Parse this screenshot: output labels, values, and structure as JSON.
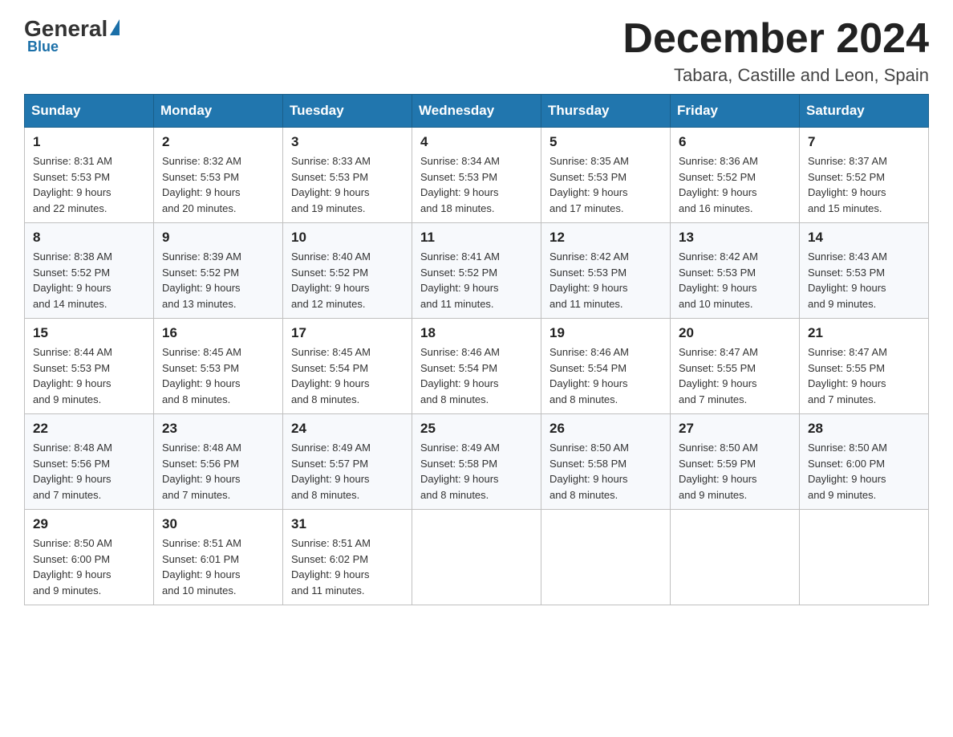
{
  "logo": {
    "general": "General",
    "blue": "Blue"
  },
  "header": {
    "month": "December 2024",
    "location": "Tabara, Castille and Leon, Spain"
  },
  "days_of_week": [
    "Sunday",
    "Monday",
    "Tuesday",
    "Wednesday",
    "Thursday",
    "Friday",
    "Saturday"
  ],
  "weeks": [
    [
      {
        "day": "1",
        "sunrise": "8:31 AM",
        "sunset": "5:53 PM",
        "daylight": "9 hours and 22 minutes."
      },
      {
        "day": "2",
        "sunrise": "8:32 AM",
        "sunset": "5:53 PM",
        "daylight": "9 hours and 20 minutes."
      },
      {
        "day": "3",
        "sunrise": "8:33 AM",
        "sunset": "5:53 PM",
        "daylight": "9 hours and 19 minutes."
      },
      {
        "day": "4",
        "sunrise": "8:34 AM",
        "sunset": "5:53 PM",
        "daylight": "9 hours and 18 minutes."
      },
      {
        "day": "5",
        "sunrise": "8:35 AM",
        "sunset": "5:53 PM",
        "daylight": "9 hours and 17 minutes."
      },
      {
        "day": "6",
        "sunrise": "8:36 AM",
        "sunset": "5:52 PM",
        "daylight": "9 hours and 16 minutes."
      },
      {
        "day": "7",
        "sunrise": "8:37 AM",
        "sunset": "5:52 PM",
        "daylight": "9 hours and 15 minutes."
      }
    ],
    [
      {
        "day": "8",
        "sunrise": "8:38 AM",
        "sunset": "5:52 PM",
        "daylight": "9 hours and 14 minutes."
      },
      {
        "day": "9",
        "sunrise": "8:39 AM",
        "sunset": "5:52 PM",
        "daylight": "9 hours and 13 minutes."
      },
      {
        "day": "10",
        "sunrise": "8:40 AM",
        "sunset": "5:52 PM",
        "daylight": "9 hours and 12 minutes."
      },
      {
        "day": "11",
        "sunrise": "8:41 AM",
        "sunset": "5:52 PM",
        "daylight": "9 hours and 11 minutes."
      },
      {
        "day": "12",
        "sunrise": "8:42 AM",
        "sunset": "5:53 PM",
        "daylight": "9 hours and 11 minutes."
      },
      {
        "day": "13",
        "sunrise": "8:42 AM",
        "sunset": "5:53 PM",
        "daylight": "9 hours and 10 minutes."
      },
      {
        "day": "14",
        "sunrise": "8:43 AM",
        "sunset": "5:53 PM",
        "daylight": "9 hours and 9 minutes."
      }
    ],
    [
      {
        "day": "15",
        "sunrise": "8:44 AM",
        "sunset": "5:53 PM",
        "daylight": "9 hours and 9 minutes."
      },
      {
        "day": "16",
        "sunrise": "8:45 AM",
        "sunset": "5:53 PM",
        "daylight": "9 hours and 8 minutes."
      },
      {
        "day": "17",
        "sunrise": "8:45 AM",
        "sunset": "5:54 PM",
        "daylight": "9 hours and 8 minutes."
      },
      {
        "day": "18",
        "sunrise": "8:46 AM",
        "sunset": "5:54 PM",
        "daylight": "9 hours and 8 minutes."
      },
      {
        "day": "19",
        "sunrise": "8:46 AM",
        "sunset": "5:54 PM",
        "daylight": "9 hours and 8 minutes."
      },
      {
        "day": "20",
        "sunrise": "8:47 AM",
        "sunset": "5:55 PM",
        "daylight": "9 hours and 7 minutes."
      },
      {
        "day": "21",
        "sunrise": "8:47 AM",
        "sunset": "5:55 PM",
        "daylight": "9 hours and 7 minutes."
      }
    ],
    [
      {
        "day": "22",
        "sunrise": "8:48 AM",
        "sunset": "5:56 PM",
        "daylight": "9 hours and 7 minutes."
      },
      {
        "day": "23",
        "sunrise": "8:48 AM",
        "sunset": "5:56 PM",
        "daylight": "9 hours and 7 minutes."
      },
      {
        "day": "24",
        "sunrise": "8:49 AM",
        "sunset": "5:57 PM",
        "daylight": "9 hours and 8 minutes."
      },
      {
        "day": "25",
        "sunrise": "8:49 AM",
        "sunset": "5:58 PM",
        "daylight": "9 hours and 8 minutes."
      },
      {
        "day": "26",
        "sunrise": "8:50 AM",
        "sunset": "5:58 PM",
        "daylight": "9 hours and 8 minutes."
      },
      {
        "day": "27",
        "sunrise": "8:50 AM",
        "sunset": "5:59 PM",
        "daylight": "9 hours and 9 minutes."
      },
      {
        "day": "28",
        "sunrise": "8:50 AM",
        "sunset": "6:00 PM",
        "daylight": "9 hours and 9 minutes."
      }
    ],
    [
      {
        "day": "29",
        "sunrise": "8:50 AM",
        "sunset": "6:00 PM",
        "daylight": "9 hours and 9 minutes."
      },
      {
        "day": "30",
        "sunrise": "8:51 AM",
        "sunset": "6:01 PM",
        "daylight": "9 hours and 10 minutes."
      },
      {
        "day": "31",
        "sunrise": "8:51 AM",
        "sunset": "6:02 PM",
        "daylight": "9 hours and 11 minutes."
      },
      null,
      null,
      null,
      null
    ]
  ],
  "labels": {
    "sunrise": "Sunrise:",
    "sunset": "Sunset:",
    "daylight": "Daylight:"
  }
}
